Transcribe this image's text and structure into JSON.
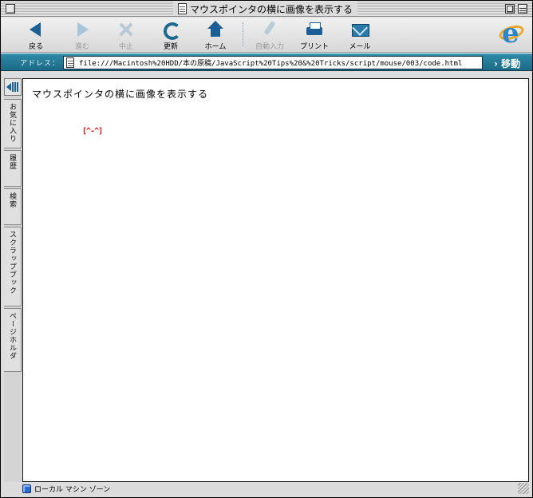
{
  "window": {
    "title": "マウスポインタの横に画像を表示する"
  },
  "toolbar": {
    "buttons": [
      {
        "label": "戻る",
        "icon": "back-arrow-icon",
        "enabled": true
      },
      {
        "label": "進む",
        "icon": "forward-arrow-icon",
        "enabled": false
      },
      {
        "label": "中止",
        "icon": "stop-icon",
        "enabled": false
      },
      {
        "label": "更新",
        "icon": "refresh-icon",
        "enabled": true
      },
      {
        "label": "ホーム",
        "icon": "home-icon",
        "enabled": true
      },
      {
        "label": "自動入力",
        "icon": "autofill-icon",
        "enabled": false
      },
      {
        "label": "プリント",
        "icon": "printer-icon",
        "enabled": true
      },
      {
        "label": "メール",
        "icon": "mail-icon",
        "enabled": true
      }
    ]
  },
  "address": {
    "label": "アドレス：",
    "url": "file:///Macintosh%20HDD/本の原稿/JavaScript%20Tips%20&%20Tricks/script/mouse/003/code.html",
    "go_label": "› 移動"
  },
  "sidebar": {
    "tabs": [
      "お気に入り",
      "履歴",
      "検索",
      "スクラップブック",
      "ページホルダ"
    ]
  },
  "page": {
    "heading": "マウスポインタの横に画像を表示する",
    "cursor_image_text": "[^-^]"
  },
  "status": {
    "zone": "ローカル マシン ゾーン"
  },
  "colors": {
    "accent": "#1c6a86",
    "cursor_image": "#e01010"
  }
}
